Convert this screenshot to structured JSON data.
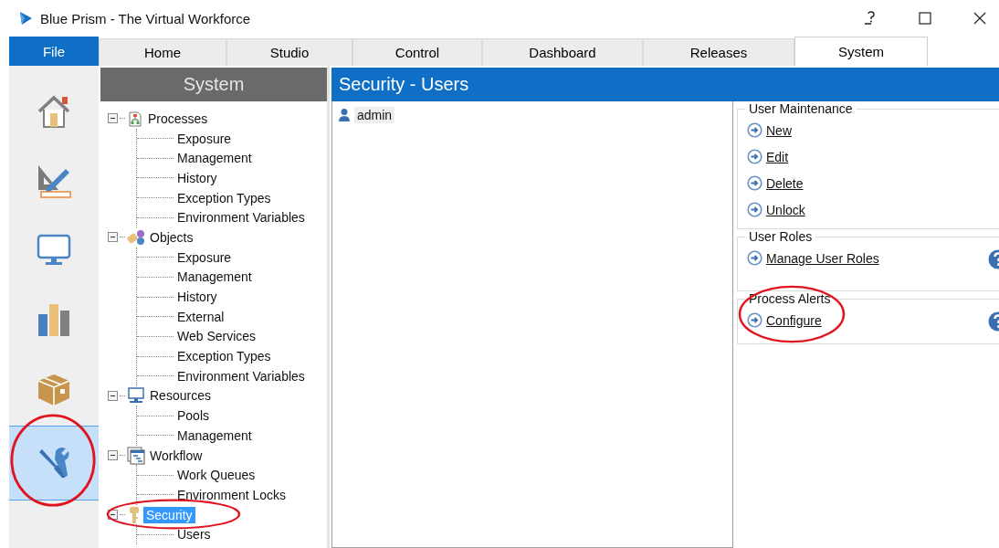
{
  "window": {
    "title": "Blue Prism - The Virtual Workforce"
  },
  "file_tab": {
    "label": "File"
  },
  "tabs": [
    {
      "label": "Home",
      "selected": false
    },
    {
      "label": "Studio",
      "selected": false
    },
    {
      "label": "Control",
      "selected": false
    },
    {
      "label": "Dashboard",
      "selected": false
    },
    {
      "label": "Releases",
      "selected": false
    },
    {
      "label": "System",
      "selected": true
    }
  ],
  "rail": [
    {
      "kind": "home",
      "selected": false,
      "circled": false
    },
    {
      "kind": "studio",
      "selected": false,
      "circled": false
    },
    {
      "kind": "control",
      "selected": false,
      "circled": false
    },
    {
      "kind": "dashboard",
      "selected": false,
      "circled": false
    },
    {
      "kind": "releases",
      "selected": false,
      "circled": false
    },
    {
      "kind": "system",
      "selected": true,
      "circled": true
    }
  ],
  "tree": {
    "title": "System",
    "groups": [
      {
        "kind": "processes",
        "label": "Processes",
        "expanded": true,
        "selected": false,
        "circled": false,
        "children": [
          {
            "label": "Exposure",
            "selected": false
          },
          {
            "label": "Management",
            "selected": false
          },
          {
            "label": "History",
            "selected": false
          },
          {
            "label": "Exception Types",
            "selected": false
          },
          {
            "label": "Environment Variables",
            "selected": false
          }
        ]
      },
      {
        "kind": "objects",
        "label": "Objects",
        "expanded": true,
        "selected": false,
        "circled": false,
        "children": [
          {
            "label": "Exposure",
            "selected": false
          },
          {
            "label": "Management",
            "selected": false
          },
          {
            "label": "History",
            "selected": false
          },
          {
            "label": "External",
            "selected": false
          },
          {
            "label": "Web Services",
            "selected": false
          },
          {
            "label": "Exception Types",
            "selected": false
          },
          {
            "label": "Environment Variables",
            "selected": false
          }
        ]
      },
      {
        "kind": "resources",
        "label": "Resources",
        "expanded": true,
        "selected": false,
        "circled": false,
        "children": [
          {
            "label": "Pools",
            "selected": false
          },
          {
            "label": "Management",
            "selected": false
          }
        ]
      },
      {
        "kind": "workflow",
        "label": "Workflow",
        "expanded": true,
        "selected": false,
        "circled": false,
        "children": [
          {
            "label": "Work Queues",
            "selected": false
          },
          {
            "label": "Environment Locks",
            "selected": false
          }
        ]
      },
      {
        "kind": "security",
        "label": "Security",
        "expanded": true,
        "selected": true,
        "circled": true,
        "children": [
          {
            "label": "Users",
            "selected": false
          }
        ]
      }
    ]
  },
  "main": {
    "title": "Security - Users",
    "users": [
      {
        "name": "admin",
        "selected": true
      }
    ],
    "sections": [
      {
        "title": "User Maintenance",
        "help": false,
        "circled": false,
        "links": [
          "New",
          "Edit",
          "Delete",
          "Unlock"
        ]
      },
      {
        "title": "User Roles",
        "help": true,
        "circled": false,
        "links": [
          "Manage User Roles"
        ]
      },
      {
        "title": "Process Alerts",
        "help": true,
        "circled": true,
        "links": [
          "Configure"
        ]
      }
    ]
  }
}
